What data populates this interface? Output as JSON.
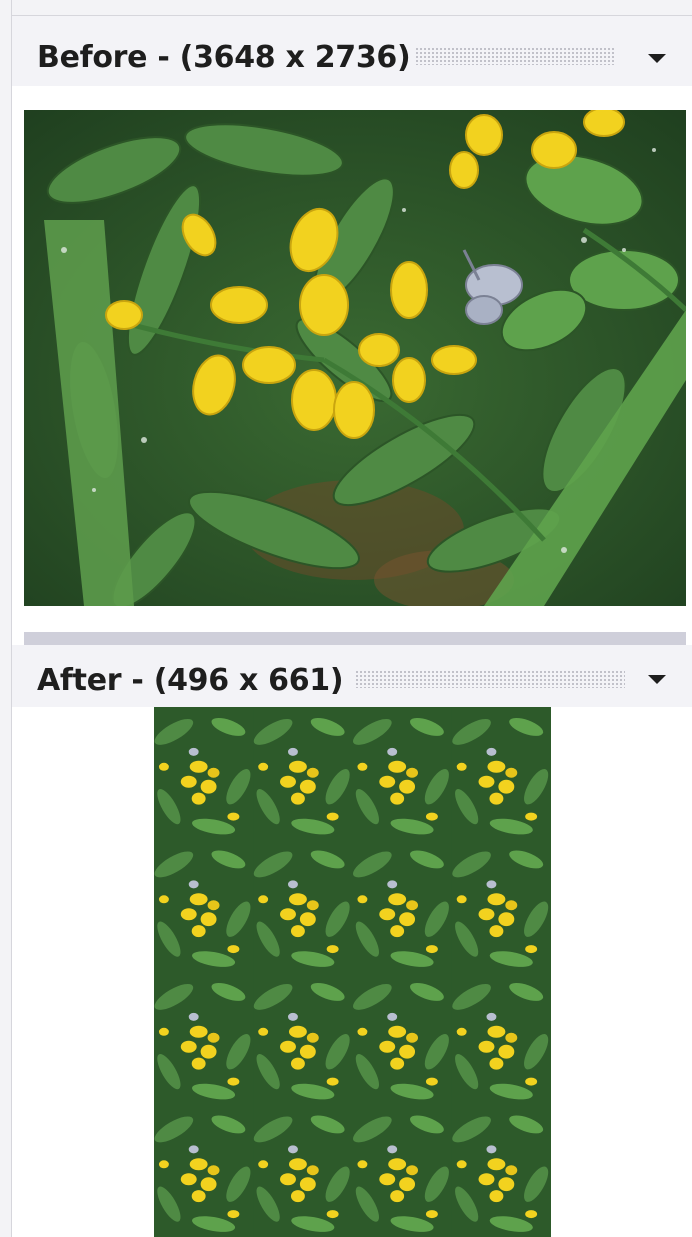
{
  "before_pane": {
    "title": "Before - (3648 x 2736)",
    "menu_icon": "chevron-down-icon"
  },
  "after_pane": {
    "title": "After - (496 x 661)",
    "menu_icon": "chevron-down-icon"
  },
  "colors": {
    "header_bg": "#f3f3f7",
    "separator": "#cfcfda",
    "leaf_dark": "#2f5d2c",
    "leaf_light": "#4f8a44",
    "flower_yellow": "#f2d21f"
  },
  "after_tile_grid": {
    "columns": 4,
    "rows": 4
  }
}
